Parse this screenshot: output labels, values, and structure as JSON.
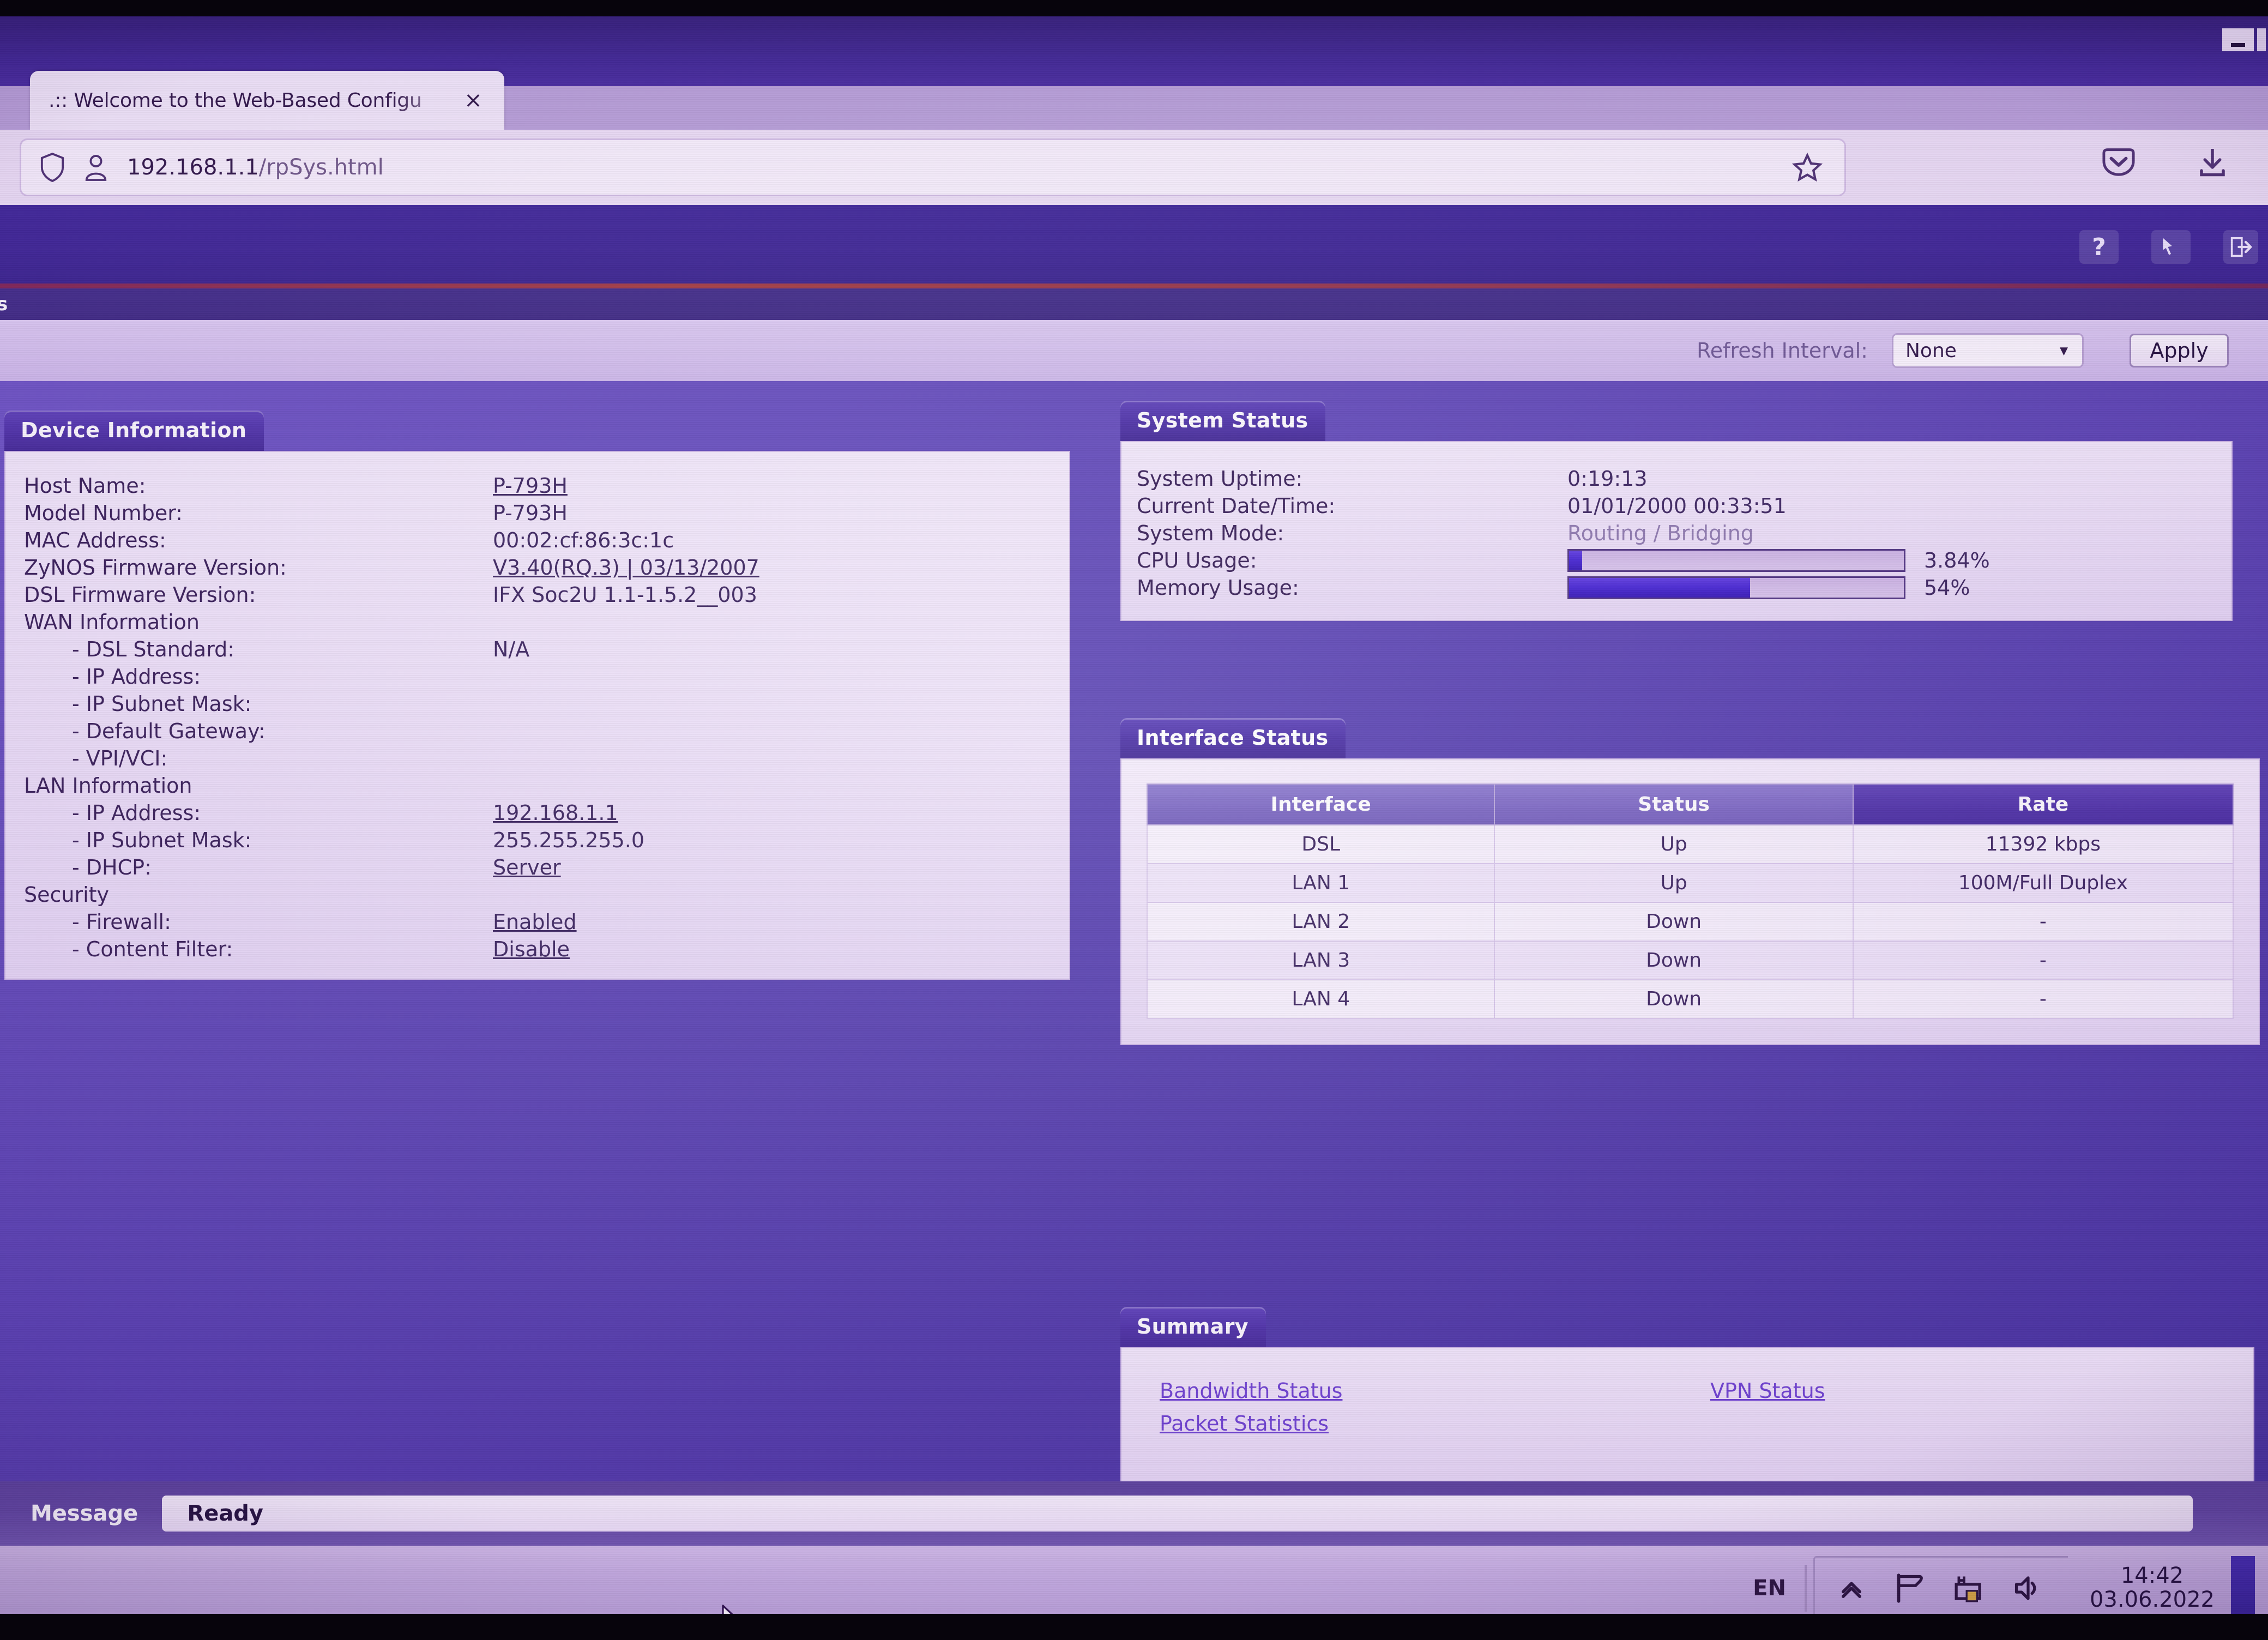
{
  "browser": {
    "tab_title": ".:: Welcome to the Web-Based Configu",
    "tab_close_glyph": "×",
    "url": "192.168.1.1",
    "url_path": "/rpSys.html",
    "icons": {
      "shield": "shield-icon",
      "identity": "person-icon",
      "bookmark_star": "star-icon",
      "pocket": "pocket-icon",
      "download": "download-icon"
    },
    "window_controls": [
      "minimize",
      "restore"
    ]
  },
  "router_header": {
    "help_label": "?",
    "wizard_label": "wizard-icon",
    "logout_label": "logout-icon"
  },
  "breadcrumb": {
    "text": "s"
  },
  "toolbar": {
    "refresh_label": "Refresh Interval:",
    "refresh_value": "None",
    "refresh_options": [
      "None"
    ],
    "apply_label": "Apply"
  },
  "device_information": {
    "title": "Device Information",
    "rows": [
      {
        "label": "Host Name:",
        "value": "P-793H",
        "link": true,
        "indent": false
      },
      {
        "label": "Model Number:",
        "value": "P-793H",
        "link": false,
        "indent": false
      },
      {
        "label": "MAC Address:",
        "value": "00:02:cf:86:3c:1c",
        "link": false,
        "indent": false
      },
      {
        "label": "ZyNOS Firmware Version:",
        "value": "V3.40(RQ.3) | 03/13/2007",
        "link": true,
        "indent": false
      },
      {
        "label": "DSL Firmware Version:",
        "value": "IFX Soc2U 1.1-1.5.2__003",
        "link": false,
        "indent": false
      },
      {
        "label": "WAN Information",
        "value": "",
        "link": false,
        "indent": false
      },
      {
        "label": "- DSL Standard:",
        "value": "N/A",
        "link": false,
        "indent": true
      },
      {
        "label": "- IP Address:",
        "value": "",
        "link": false,
        "indent": true
      },
      {
        "label": "- IP Subnet Mask:",
        "value": "",
        "link": false,
        "indent": true
      },
      {
        "label": "- Default Gateway:",
        "value": "",
        "link": false,
        "indent": true
      },
      {
        "label": "- VPI/VCI:",
        "value": "",
        "link": false,
        "indent": true
      },
      {
        "label": "LAN Information",
        "value": "",
        "link": false,
        "indent": false
      },
      {
        "label": "- IP Address:",
        "value": "192.168.1.1",
        "link": true,
        "indent": true
      },
      {
        "label": "- IP Subnet Mask:",
        "value": "255.255.255.0",
        "link": false,
        "indent": true
      },
      {
        "label": "- DHCP:",
        "value": "Server",
        "link": true,
        "indent": true
      },
      {
        "label": "Security",
        "value": "",
        "link": false,
        "indent": false
      },
      {
        "label": "- Firewall:",
        "value": "Enabled",
        "link": true,
        "indent": true
      },
      {
        "label": "- Content Filter:",
        "value": "Disable",
        "link": true,
        "indent": true
      }
    ]
  },
  "system_status": {
    "title": "System Status",
    "uptime_label": "System Uptime:",
    "uptime_value": "0:19:13",
    "datetime_label": "Current Date/Time:",
    "datetime_value": "01/01/2000      00:33:51",
    "mode_label": "System Mode:",
    "mode_value": "Routing / Bridging",
    "cpu_label": "CPU Usage:",
    "cpu_percent": 3.84,
    "cpu_text": "3.84%",
    "mem_label": "Memory Usage:",
    "mem_percent": 54,
    "mem_text": "54%"
  },
  "interface_status": {
    "title": "Interface Status",
    "columns": [
      "Interface",
      "Status",
      "Rate"
    ],
    "rows": [
      [
        "DSL",
        "Up",
        "11392 kbps"
      ],
      [
        "LAN 1",
        "Up",
        "100M/Full Duplex"
      ],
      [
        "LAN 2",
        "Down",
        "-"
      ],
      [
        "LAN 3",
        "Down",
        "-"
      ],
      [
        "LAN 4",
        "Down",
        "-"
      ]
    ]
  },
  "summary": {
    "title": "Summary",
    "links_left": [
      "Bandwidth Status",
      "Packet Statistics"
    ],
    "links_right": [
      "VPN Status"
    ]
  },
  "message_bar": {
    "label": "Message",
    "value": "Ready"
  },
  "taskbar": {
    "language": "EN",
    "icons": [
      "chevron-up-icon",
      "flag-icon",
      "network-icon",
      "volume-icon"
    ],
    "time": "14:42",
    "date": "03.06.2022"
  }
}
